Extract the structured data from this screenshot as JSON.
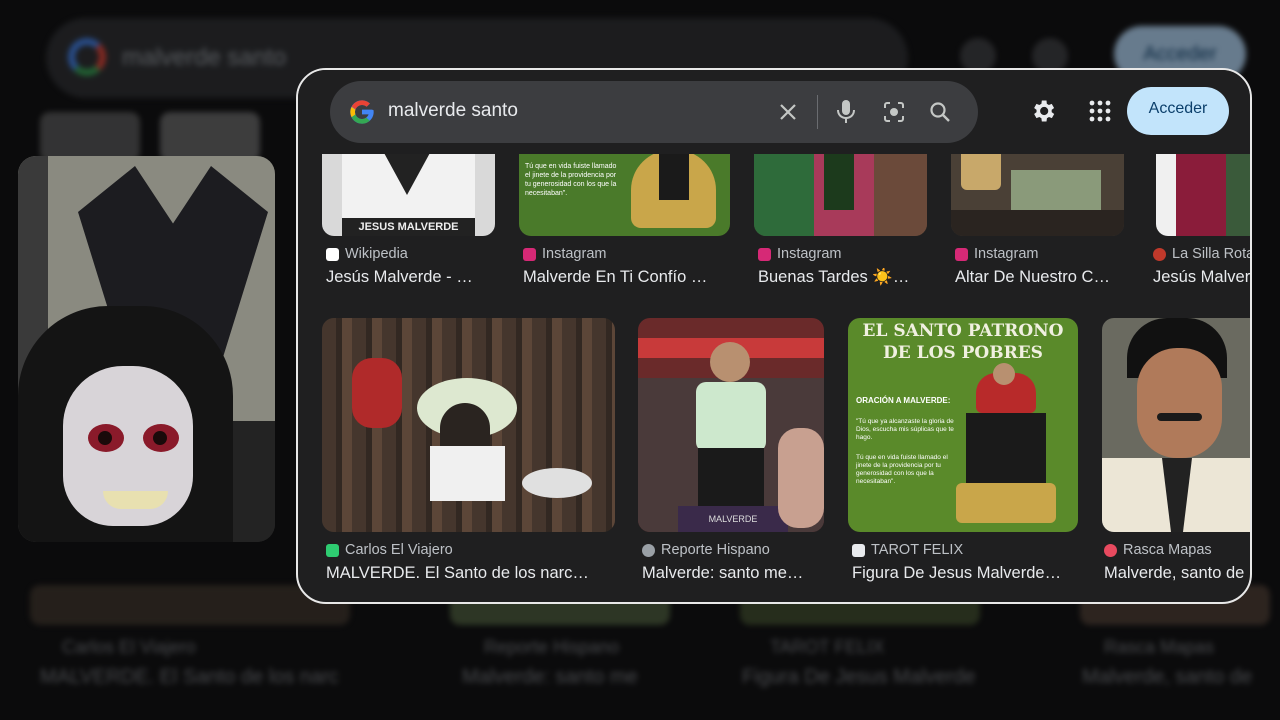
{
  "search": {
    "query": "malverde santo"
  },
  "header": {
    "signin_label": "Acceder"
  },
  "row1": [
    {
      "source": "Wikipedia",
      "title": "Jesús Malverde - …",
      "fav": "#ffffff",
      "thumb_text": "JESUS MALVERDE"
    },
    {
      "source": "Instagram",
      "title": "Malverde En Ti Confío …",
      "fav": "#d62976",
      "thumb_text": "Tú que en vida fuiste llamado el jinete de la providencia por tu generosidad con los que la necesitaban\"."
    },
    {
      "source": "Instagram",
      "title": "Buenas Tardes ☀️…",
      "fav": "#d62976"
    },
    {
      "source": "Instagram",
      "title": "Altar De Nuestro C…",
      "fav": "#d62976"
    },
    {
      "source": "La Silla Rota",
      "title": "Jesús Malver",
      "fav": "#c0392b"
    }
  ],
  "row2": [
    {
      "source": "Carlos El Viajero",
      "title": "MALVERDE. El Santo de los narc…",
      "fav": "#2ecc71"
    },
    {
      "source": "Reporte Hispano",
      "title": "Malverde: santo me…",
      "fav": "#9aa0a6",
      "thumb_text": "MALVERDE"
    },
    {
      "source": "TAROT FELIX",
      "title": "Figura De Jesus Malverde…",
      "fav": "#e8eaed",
      "poster": {
        "heading1": "EL SANTO PATRONO",
        "heading2": "DE LOS POBRES",
        "sub": "ORACIÓN A MALVERDE:",
        "p1": "\"Tú que ya alcanzaste la gloria de Dios, escucha mis súplicas que te hago.",
        "p2": "Tú que en vida fuiste llamado el jinete de la providencia por tu generosidad con los que la necesitaban\"."
      }
    },
    {
      "source": "Rasca Mapas",
      "title": "Malverde, santo de",
      "fav": "#e84a5f"
    }
  ],
  "background": {
    "query": "malverde santo",
    "button": "Acceder",
    "items": [
      {
        "source": "Carlos El Viajero",
        "title": "MALVERDE. El Santo de los narc"
      },
      {
        "source": "Reporte Hispano",
        "title": "Malverde: santo me"
      },
      {
        "source": "TAROT FELIX",
        "title": "Figura De Jesus Malverde"
      },
      {
        "source": "Rasca Mapas",
        "title": "Malverde, santo de"
      }
    ]
  }
}
